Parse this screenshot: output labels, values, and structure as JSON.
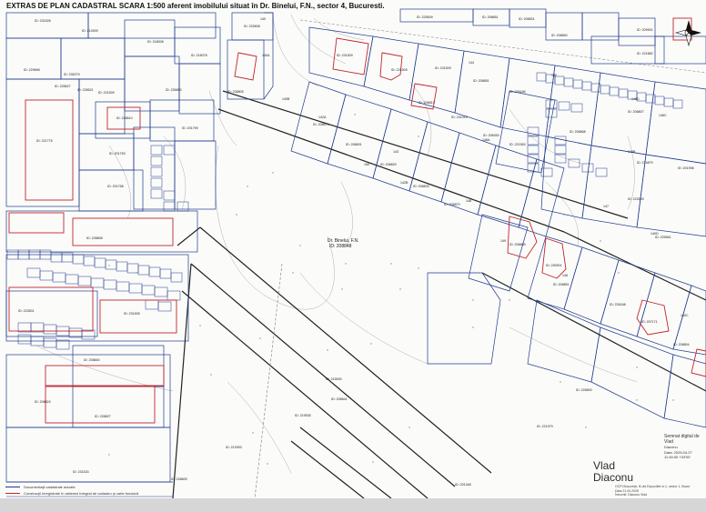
{
  "title": "EXTRAS DE PLAN CADASTRAL SCARA 1:500 aferent imobilului situat în Dr. Binelui, F.N., sector 4, Bucuresti.",
  "subject_label_1": "Dr. Binelui, F.N.",
  "subject_label_2": "ID: 208848",
  "north_icon": "compass-north-icon",
  "colors": {
    "parcel_line": "#1f3b8a",
    "building": "#c0262c",
    "road": "#222222",
    "contour": "#9a9a9a",
    "paper": "#fbfbfa"
  },
  "legend": [
    {
      "label": "Documentaţii cadastrale avizate",
      "color": "#1f3b8a"
    },
    {
      "label": "Construcţii înregistrate în sistemul integrat de cadastru şi carte funciară",
      "color": "#c0262c"
    }
  ],
  "signature": {
    "name_line_1": "Vlad",
    "name_line_2": "Diaconu",
    "box_title": "Semnat digital de Vlad",
    "box_lines": [
      "Diaconu",
      "Data: 2025.04.27",
      "11:46:05 +03'00'"
    ]
  },
  "footer_note": [
    "OCPI București, B-dul Expozitiei nr.1, sector 1, Bucur",
    "Data 21.04.2025",
    "Întocmit: Diaconu Vlad"
  ],
  "parcel_ids": [
    {
      "text": "ID: 231528"
    },
    {
      "text": "ID: 214909"
    },
    {
      "text": "ID: 218008"
    },
    {
      "text": "ID: 218078"
    },
    {
      "text": "ID: 229898"
    },
    {
      "text": "ID: 235279"
    },
    {
      "text": "ID: 228527"
    },
    {
      "text": "ID: 228521"
    },
    {
      "text": "ID: 221509"
    },
    {
      "text": "ID: 235850"
    },
    {
      "text": "ID: 221776"
    },
    {
      "text": "ID: 201753"
    },
    {
      "text": "ID: 201758"
    },
    {
      "text": "ID: 201799"
    },
    {
      "text": "ID: 228610"
    },
    {
      "text": "ID: 232608"
    },
    {
      "text": "ID: 228805"
    },
    {
      "text": "ID: 228808"
    },
    {
      "text": "ID: 215530"
    },
    {
      "text": "ID: 223501"
    },
    {
      "text": "ID: 231905"
    },
    {
      "text": "ID: 208840"
    },
    {
      "text": "ID: 208824"
    },
    {
      "text": "ID: 228827"
    },
    {
      "text": "ID: 231524"
    },
    {
      "text": "ID: 228825"
    },
    {
      "text": "ID: 212993"
    },
    {
      "text": "ID: 219535"
    },
    {
      "text": "ID: 208841"
    },
    {
      "text": "ID: 201348"
    },
    {
      "text": "ID: 231509"
    },
    {
      "text": "ID: 221509"
    },
    {
      "text": "ID: 231509"
    },
    {
      "text": "ID: 208851"
    },
    {
      "text": "ID: 226186"
    },
    {
      "text": "ID: 208813"
    },
    {
      "text": "ID: 231919"
    },
    {
      "text": "ID: 206930"
    },
    {
      "text": "ID: 208871"
    },
    {
      "text": "ID: 208831"
    },
    {
      "text": "ID: 208829"
    },
    {
      "text": "ID: 208833"
    },
    {
      "text": "ID: 208870"
    },
    {
      "text": "ID: 208859"
    },
    {
      "text": "ID: 230901"
    },
    {
      "text": "ID: 208851"
    },
    {
      "text": "ID: 226168"
    },
    {
      "text": "ID: 207171"
    },
    {
      "text": "ID: 208804"
    },
    {
      "text": "ID: 226800"
    },
    {
      "text": "ID: 221979"
    },
    {
      "text": "ID: 223009"
    },
    {
      "text": "ID: 225561"
    },
    {
      "text": "ID: 214879"
    },
    {
      "text": "ID: 201998"
    },
    {
      "text": "ID: 225509"
    },
    {
      "text": "ID: 208851"
    },
    {
      "text": "ID: 208831"
    },
    {
      "text": "ID: 209901"
    },
    {
      "text": "ID: 221882"
    },
    {
      "text": "ID: 208840"
    },
    {
      "text": "ID: 208807"
    },
    {
      "text": "ID: 208868"
    },
    {
      "text": "ID: 221563"
    }
  ],
  "plot_numbers": [
    {
      "text": "140"
    },
    {
      "text": "140A"
    },
    {
      "text": "140B"
    },
    {
      "text": "140C"
    },
    {
      "text": "140D"
    },
    {
      "text": "142A"
    },
    {
      "text": "142B"
    },
    {
      "text": "143"
    },
    {
      "text": "144"
    },
    {
      "text": "146"
    },
    {
      "text": "146A"
    },
    {
      "text": "146B"
    },
    {
      "text": "146C"
    },
    {
      "text": "146D"
    },
    {
      "text": "147"
    },
    {
      "text": "148"
    },
    {
      "text": "149"
    },
    {
      "text": "150"
    },
    {
      "text": "152"
    }
  ]
}
